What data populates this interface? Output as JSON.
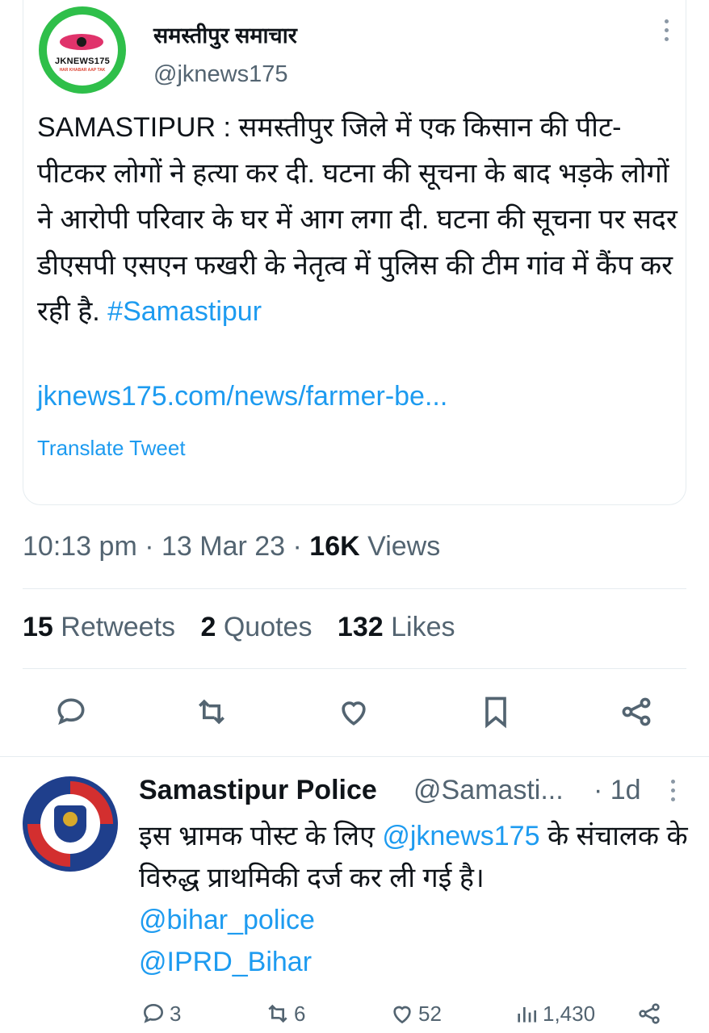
{
  "tweet": {
    "author_name": "समस्तीपुर समाचार",
    "author_handle": "@jknews175",
    "logo_text": "JKNEWS175",
    "logo_subtext": "HAR KHABAR AAP TAK",
    "text_main": "SAMASTIPUR : समस्तीपुर जिले में एक किसान की पीट-पीटकर लोगों ने हत्या कर दी. घटना की सूचना के बाद भड़के लोगों ने आरोपी परिवार के घर में आग लगा दी. घटना की सूचना पर सदर डीएसपी एसएन फखरी के नेतृत्व में पुलिस की टीम गांव में कैंप कर रही है.",
    "hashtag": "#Samastipur",
    "link": "jknews175.com/news/farmer-be...",
    "translate_label": "Translate Tweet",
    "time": "10:13 pm",
    "date": "13 Mar 23",
    "views_count": "16K",
    "views_label": "Views",
    "retweets_count": "15",
    "retweets_label": "Retweets",
    "quotes_count": "2",
    "quotes_label": "Quotes",
    "likes_count": "132",
    "likes_label": "Likes",
    "accent_color": "#1d9bf0"
  },
  "actions": [
    "reply-icon",
    "retweet-icon",
    "like-icon",
    "bookmark-icon",
    "share-icon"
  ],
  "reply": {
    "author_name": "Samastipur Police",
    "author_handle": "@Samasti...",
    "time": "· 1d",
    "text_before": "इस भ्रामक पोस्ट के लिए ",
    "mention_inline": "@jknews175",
    "text_after": " के संचालक के विरुद्ध प्राथमिकी दर्ज कर ली गई है।",
    "mention_1": "@bihar_police",
    "mention_2": "@IPRD_Bihar",
    "replies": "3",
    "retweets": "6",
    "likes": "52",
    "views": "1,430"
  }
}
